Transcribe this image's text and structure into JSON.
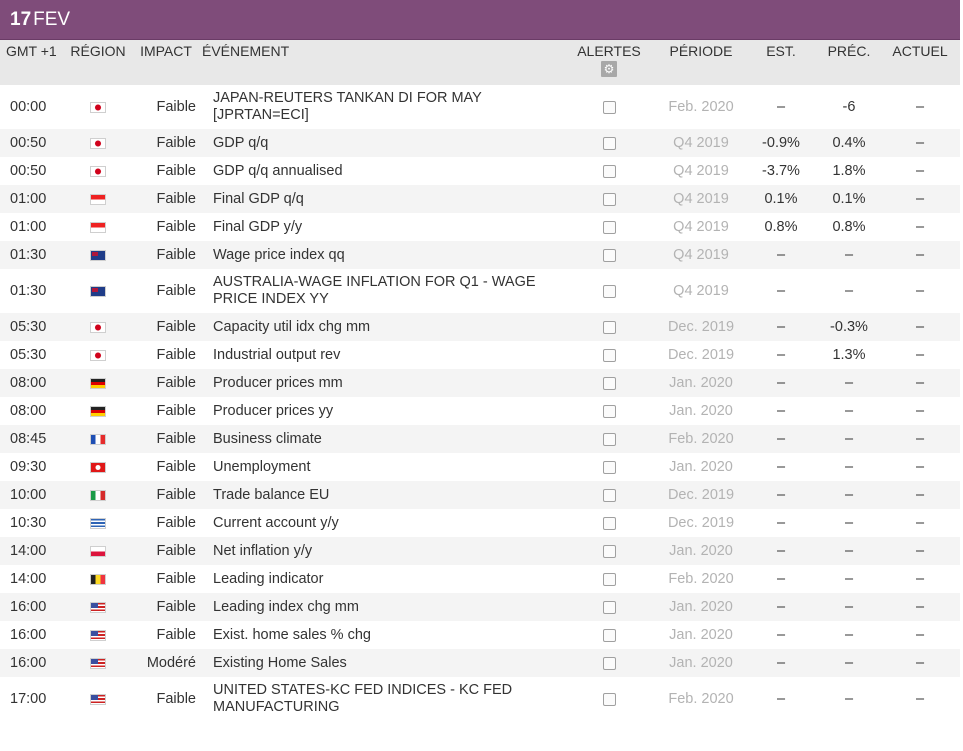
{
  "date": {
    "day": "17",
    "month": "FEV"
  },
  "colors": {
    "header_bg": "#7f4c7a",
    "header_text": "#ffffff",
    "period_text": "#b3b3b3"
  },
  "columns": {
    "time": "GMT +1",
    "region": "RÉGION",
    "impact": "IMPACT",
    "event": "ÉVÉNEMENT",
    "alerts": "ALERTES",
    "alerts_icon": "gear-icon",
    "period": "PÉRIODE",
    "est": "EST.",
    "prev": "PRÉC.",
    "actual": "ACTUEL"
  },
  "rows": [
    {
      "time": "00:00",
      "flag": "jp",
      "impact": "Faible",
      "event": "JAPAN-REUTERS TANKAN DI FOR MAY [JPRTAN=ECI]",
      "period": "Feb. 2020",
      "est": "–",
      "prev": "-6",
      "actual": "–",
      "tall": true
    },
    {
      "time": "00:50",
      "flag": "jp",
      "impact": "Faible",
      "event": "GDP q/q",
      "period": "Q4 2019",
      "est": "-0.9%",
      "prev": "0.4%",
      "actual": "–"
    },
    {
      "time": "00:50",
      "flag": "jp",
      "impact": "Faible",
      "event": "GDP q/q annualised",
      "period": "Q4 2019",
      "est": "-3.7%",
      "prev": "1.8%",
      "actual": "–"
    },
    {
      "time": "01:00",
      "flag": "sg",
      "impact": "Faible",
      "event": "Final GDP q/q",
      "period": "Q4 2019",
      "est": "0.1%",
      "prev": "0.1%",
      "actual": "–"
    },
    {
      "time": "01:00",
      "flag": "sg",
      "impact": "Faible",
      "event": "Final GDP y/y",
      "period": "Q4 2019",
      "est": "0.8%",
      "prev": "0.8%",
      "actual": "–"
    },
    {
      "time": "01:30",
      "flag": "au",
      "impact": "Faible",
      "event": "Wage price index qq",
      "period": "Q4 2019",
      "est": "–",
      "prev": "–",
      "actual": "–"
    },
    {
      "time": "01:30",
      "flag": "au",
      "impact": "Faible",
      "event": "AUSTRALIA-WAGE INFLATION FOR Q1 - WAGE PRICE INDEX YY",
      "period": "Q4 2019",
      "est": "–",
      "prev": "–",
      "actual": "–",
      "tall": true
    },
    {
      "time": "05:30",
      "flag": "jp",
      "impact": "Faible",
      "event": "Capacity util idx chg mm",
      "period": "Dec. 2019",
      "est": "–",
      "prev": "-0.3%",
      "actual": "–"
    },
    {
      "time": "05:30",
      "flag": "jp",
      "impact": "Faible",
      "event": "Industrial output rev",
      "period": "Dec. 2019",
      "est": "–",
      "prev": "1.3%",
      "actual": "–"
    },
    {
      "time": "08:00",
      "flag": "de",
      "impact": "Faible",
      "event": "Producer prices mm",
      "period": "Jan. 2020",
      "est": "–",
      "prev": "–",
      "actual": "–"
    },
    {
      "time": "08:00",
      "flag": "de",
      "impact": "Faible",
      "event": "Producer prices yy",
      "period": "Jan. 2020",
      "est": "–",
      "prev": "–",
      "actual": "–"
    },
    {
      "time": "08:45",
      "flag": "fr",
      "impact": "Faible",
      "event": "Business climate",
      "period": "Feb. 2020",
      "est": "–",
      "prev": "–",
      "actual": "–"
    },
    {
      "time": "09:30",
      "flag": "hk",
      "impact": "Faible",
      "event": "Unemployment",
      "period": "Jan. 2020",
      "est": "–",
      "prev": "–",
      "actual": "–"
    },
    {
      "time": "10:00",
      "flag": "it",
      "impact": "Faible",
      "event": "Trade balance EU",
      "period": "Dec. 2019",
      "est": "–",
      "prev": "–",
      "actual": "–"
    },
    {
      "time": "10:30",
      "flag": "gr",
      "impact": "Faible",
      "event": "Current account y/y",
      "period": "Dec. 2019",
      "est": "–",
      "prev": "–",
      "actual": "–"
    },
    {
      "time": "14:00",
      "flag": "pl",
      "impact": "Faible",
      "event": "Net inflation y/y",
      "period": "Jan. 2020",
      "est": "–",
      "prev": "–",
      "actual": "–"
    },
    {
      "time": "14:00",
      "flag": "be",
      "impact": "Faible",
      "event": "Leading indicator",
      "period": "Feb. 2020",
      "est": "–",
      "prev": "–",
      "actual": "–"
    },
    {
      "time": "16:00",
      "flag": "us",
      "impact": "Faible",
      "event": "Leading index chg mm",
      "period": "Jan. 2020",
      "est": "–",
      "prev": "–",
      "actual": "–"
    },
    {
      "time": "16:00",
      "flag": "us",
      "impact": "Faible",
      "event": "Exist. home sales % chg",
      "period": "Jan. 2020",
      "est": "–",
      "prev": "–",
      "actual": "–"
    },
    {
      "time": "16:00",
      "flag": "us",
      "impact": "Modéré",
      "event": "Existing Home Sales",
      "period": "Jan. 2020",
      "est": "–",
      "prev": "–",
      "actual": "–"
    },
    {
      "time": "17:00",
      "flag": "us",
      "impact": "Faible",
      "event": "UNITED STATES-KC FED INDICES - KC FED MANUFACTURING",
      "period": "Feb. 2020",
      "est": "–",
      "prev": "–",
      "actual": "–",
      "tall": true
    }
  ]
}
